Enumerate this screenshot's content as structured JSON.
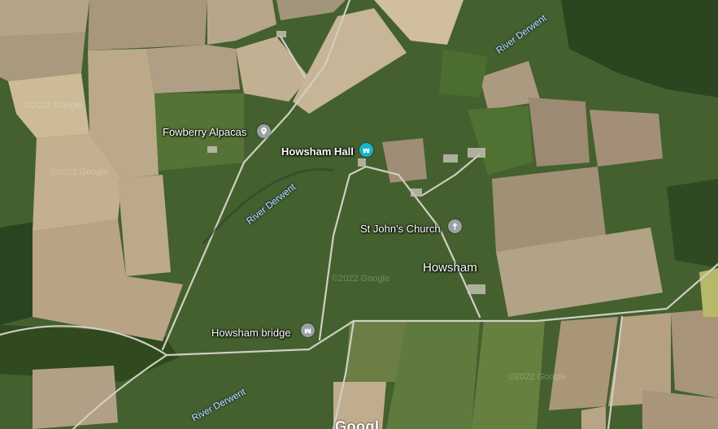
{
  "map": {
    "view": "satellite",
    "places": {
      "fowberry": "Fowberry Alpacas",
      "hall": "Howsham Hall",
      "church": "St John's Church",
      "village": "Howsham",
      "bridge": "Howsham bridge"
    },
    "rivers": [
      "River Derwent",
      "River Derwent",
      "River Derwent"
    ],
    "watermarks": [
      "©2022 Google",
      "©2022 Google",
      "©2022 Google",
      "©2022 Google"
    ],
    "brand_partial": "Googl"
  },
  "icons": {
    "fowberry": "map-pin-icon",
    "hall": "castle-icon",
    "church": "church-cross-icon",
    "bridge": "bridge-landmark-icon"
  },
  "colors": {
    "pin_grey": "#9aa0a6",
    "pin_teal": "#12b5cb",
    "river_label": "#bfe6ff"
  }
}
